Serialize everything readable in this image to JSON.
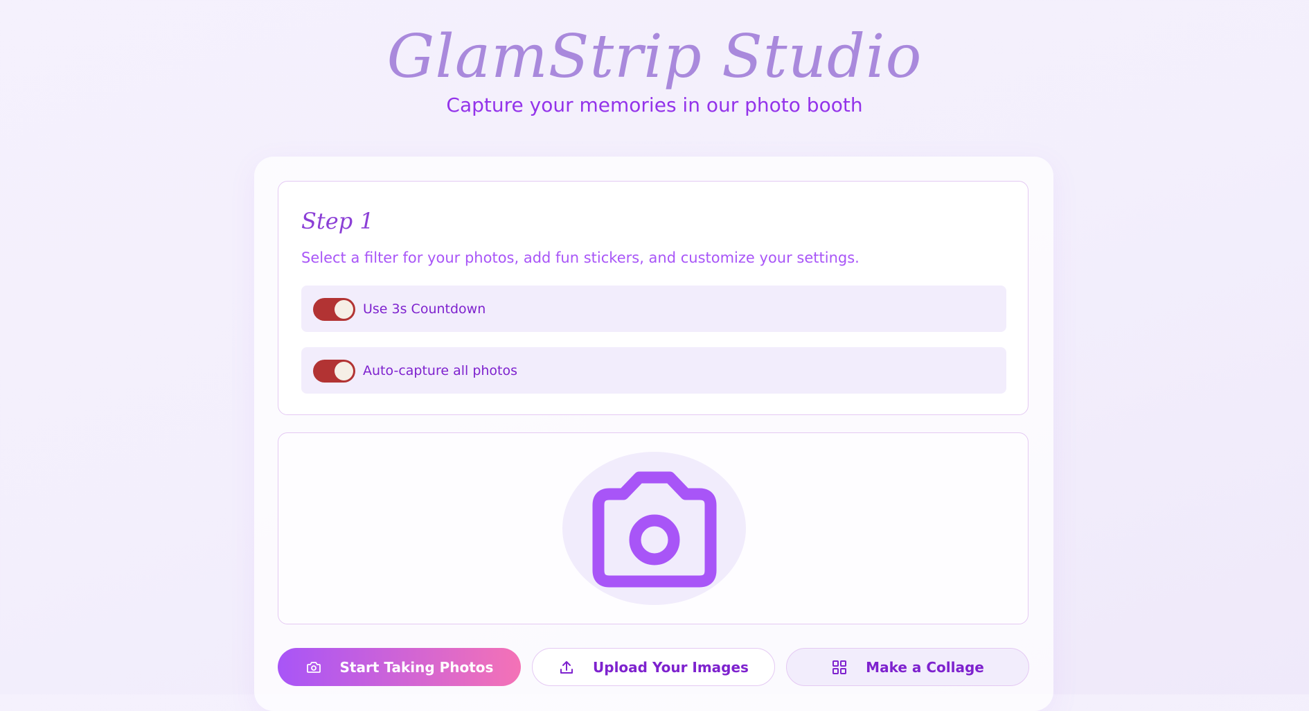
{
  "header": {
    "title": "GlamStrip Studio",
    "subtitle": "Capture your memories in our photo booth"
  },
  "step": {
    "title": "Step 1",
    "description": "Select a filter for your photos, add fun stickers, and customize your settings.",
    "options": [
      {
        "label": "Use 3s Countdown",
        "enabled": true
      },
      {
        "label": "Auto-capture all photos",
        "enabled": true
      }
    ]
  },
  "preview": {
    "icon": "camera-icon"
  },
  "actions": {
    "start_label": "Start Taking Photos",
    "start_icon": "camera-icon",
    "upload_label": "Upload Your Images",
    "upload_icon": "upload-icon",
    "collage_label": "Make a Collage",
    "collage_icon": "grid-icon"
  },
  "colors": {
    "accent": "#a855f7",
    "accent_dark": "#7e22ce",
    "toggle_on": "#b23333",
    "gradient_end": "#f472b6"
  }
}
